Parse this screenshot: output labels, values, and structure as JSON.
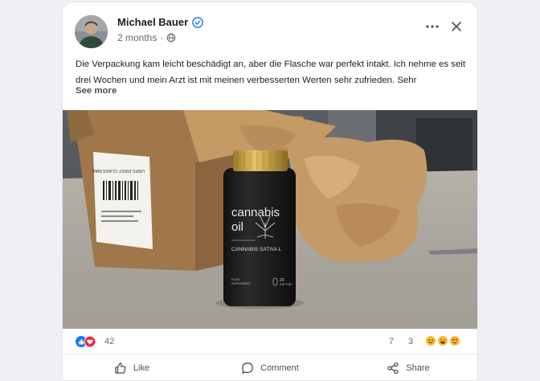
{
  "post": {
    "author": "Michael Bauer",
    "time": "2 months",
    "separator": "·",
    "verified_icon": "verified-check-icon",
    "privacy_icon": "globe-icon",
    "body": "Die Verpackung kam leicht beschädigt an, aber die Flasche war perfekt intakt. Ich nehme es seit drei Wochen und mein Arzt ist mit meinen verbesserten Werten sehr zufrieden. Sehr",
    "see_more": "See more"
  },
  "photo": {
    "box_label": "USPS FIRST CLASS MAIL",
    "bottle_text_line1": "cannabis",
    "bottle_text_line2": "oil",
    "bottle_subtitle": "CANNABIS SATIVA L",
    "bottle_footer_left_1": "FOOD",
    "bottle_footer_left_2": "SUPPLEMENT",
    "bottle_footer_right_1": "20",
    "bottle_footer_right_2": "SOFTGEL"
  },
  "stats": {
    "reactions": "42",
    "comments": "7",
    "shares": "3"
  },
  "actions": {
    "like": "Like",
    "comment": "Comment",
    "share": "Share"
  },
  "colors": {
    "like_blue": "#1877f2",
    "love_red": "#f02849",
    "verified_blue": "#1877f2",
    "text_secondary": "#65676b"
  }
}
